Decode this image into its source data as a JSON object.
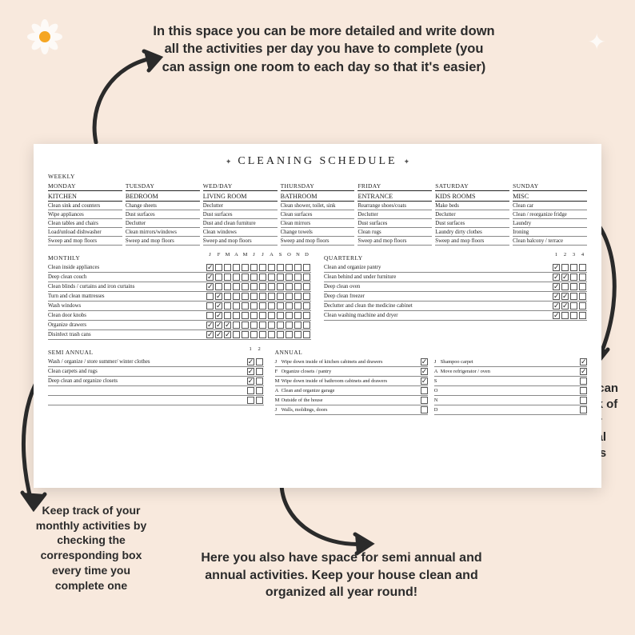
{
  "annotations": {
    "top": "In this space you can be more detailed and write down all the activities per day you have to complete (you can assign one room to each day so that it's easier)",
    "right": "Here you can keep track of all your seasonal activities",
    "bottom_left": "Keep track of your monthly activities by checking the corresponding box every time you complete one",
    "bottom": "Here you also have space for semi annual and annual activities. Keep your house clean and organized all year round!"
  },
  "page": {
    "title": "CLEANING SCHEDULE",
    "weekly": {
      "label": "WEEKLY",
      "days": [
        "MONDAY",
        "TUESDAY",
        "WED/DAY",
        "THURSDAY",
        "FRIDAY",
        "SATURDAY",
        "SUNDAY"
      ],
      "rooms": [
        "KITCHEN",
        "BEDROOM",
        "LIVING ROOM",
        "BATHROOM",
        "ENTRANCE",
        "KIDS ROOMS",
        "MISC"
      ],
      "tasks": [
        [
          "Clean sink and counters",
          "Change sheets",
          "Declutter",
          "Clean shower, toilet, sink",
          "Rearrange shoes/coats",
          "Make beds",
          "Clean car"
        ],
        [
          "Wipe appliances",
          "Dust surfaces",
          "Dust surfaces",
          "Clean surfaces",
          "Declutter",
          "Declutter",
          "Clean / reorganize fridge"
        ],
        [
          "Clean tables and chairs",
          "Declutter",
          "Dust and clean furniture",
          "Clean mirrors",
          "Dust surfaces",
          "Dust surfaces",
          "Laundry"
        ],
        [
          "Load/unload dishwasher",
          "Clean mirrors/windows",
          "Clean windows",
          "Change towels",
          "Clean rugs",
          "Laundry dirty clothes",
          "Ironing"
        ],
        [
          "Sweep and mop floors",
          "Sweep and mop floors",
          "Sweep and mop floors",
          "Sweep and mop floors",
          "Sweep and mop floors",
          "Sweep and mop floors",
          "Clean balcony / terrace"
        ]
      ]
    },
    "monthly": {
      "label": "MONTHLY",
      "months": [
        "J",
        "F",
        "M",
        "A",
        "M",
        "J",
        "J",
        "A",
        "S",
        "O",
        "N",
        "D"
      ],
      "rows": [
        {
          "label": "Clean inside appliances",
          "checked": [
            0
          ]
        },
        {
          "label": "Deep clean couch",
          "checked": [
            0
          ]
        },
        {
          "label": "Clean blinds / curtains and iron curtains",
          "checked": [
            0
          ]
        },
        {
          "label": "Turn and clean mattresses",
          "checked": [
            1
          ]
        },
        {
          "label": "Wash windows",
          "checked": [
            1
          ]
        },
        {
          "label": "Clean door knobs",
          "checked": [
            1
          ]
        },
        {
          "label": "Organize drawers",
          "checked": [
            0,
            1,
            2
          ]
        },
        {
          "label": "Disinfect trash cans",
          "checked": [
            0,
            1,
            2
          ]
        }
      ]
    },
    "quarterly": {
      "label": "QUARTERLY",
      "quarters": [
        "1",
        "2",
        "3",
        "4"
      ],
      "rows": [
        {
          "label": "Clean and organize pantry",
          "checked": [
            0
          ]
        },
        {
          "label": "Clean behind and under furniture",
          "checked": [
            0,
            1
          ]
        },
        {
          "label": "Deep clean oven",
          "checked": [
            0
          ]
        },
        {
          "label": "Deep clean freezer",
          "checked": [
            0,
            1
          ]
        },
        {
          "label": "Declutter and clean the medicine cabinet",
          "checked": [
            0,
            1
          ]
        },
        {
          "label": "Clean washing machine and dryer",
          "checked": [
            0
          ]
        }
      ]
    },
    "semi_annual": {
      "label": "SEMI ANNUAL",
      "cols": [
        "1",
        "2"
      ],
      "rows": [
        {
          "label": "Wash / organize / store summer/ winter clothes",
          "checked": [
            0
          ]
        },
        {
          "label": "Clean carpets and rugs",
          "checked": [
            0
          ]
        },
        {
          "label": "Deep clean and organize closets",
          "checked": [
            0
          ]
        },
        {
          "label": "",
          "checked": []
        },
        {
          "label": "",
          "checked": []
        }
      ]
    },
    "annual": {
      "label": "ANNUAL",
      "left": [
        {
          "m": "J",
          "label": "Wipe down inside of kitchen cabinets and drawers",
          "checked": true
        },
        {
          "m": "F",
          "label": "Organize closets / pantry",
          "checked": true
        },
        {
          "m": "M",
          "label": "Wipe down inside of bathroom cabinets and drawers",
          "checked": true
        },
        {
          "m": "A",
          "label": "Clean and organize garage",
          "checked": false
        },
        {
          "m": "M",
          "label": "Outside of the house",
          "checked": false
        },
        {
          "m": "J",
          "label": "Walls, moldings, doors",
          "checked": false
        }
      ],
      "right": [
        {
          "m": "J",
          "label": "Shampoo carpet",
          "checked": true
        },
        {
          "m": "A",
          "label": "Move refrigerator / oven",
          "checked": true
        },
        {
          "m": "S",
          "label": "",
          "checked": false
        },
        {
          "m": "O",
          "label": "",
          "checked": false
        },
        {
          "m": "N",
          "label": "",
          "checked": false
        },
        {
          "m": "D",
          "label": "",
          "checked": false
        }
      ]
    }
  }
}
